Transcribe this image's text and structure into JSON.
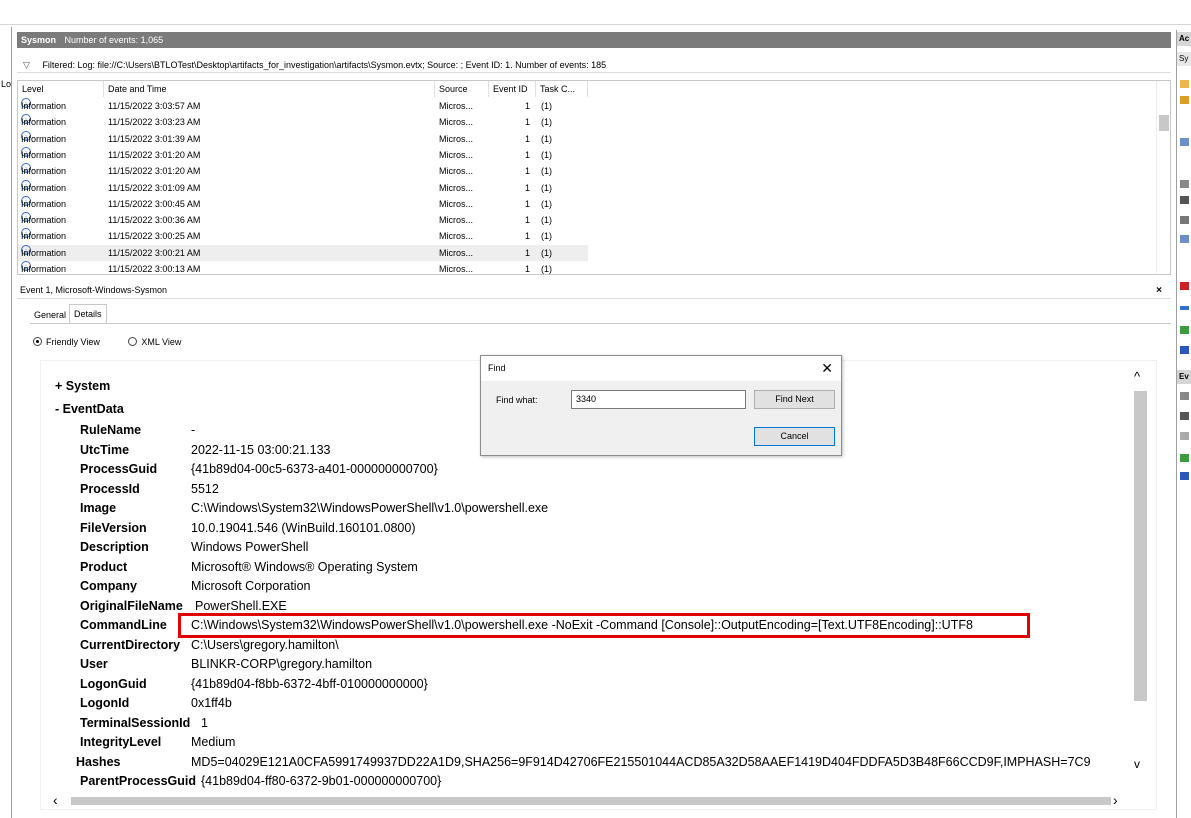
{
  "left_strip": {
    "label": "Lo"
  },
  "events_header": {
    "title": "Sysmon",
    "count_text": "Number of events: 1,065"
  },
  "filter": {
    "text": "Filtered: Log: file://C:\\Users\\BTLOTest\\Desktop\\artifacts_for_investigation\\artifacts\\Sysmon.evtx; Source: ; Event ID: 1. Number of events: 185"
  },
  "columns": [
    "Level",
    "Date and Time",
    "Source",
    "Event ID",
    "Task C..."
  ],
  "rows": [
    {
      "level": "Information",
      "date": "11/15/2022 3:03:57 AM",
      "source": "Micros...",
      "event_id": "1",
      "task": "(1)"
    },
    {
      "level": "Information",
      "date": "11/15/2022 3:03:23 AM",
      "source": "Micros...",
      "event_id": "1",
      "task": "(1)"
    },
    {
      "level": "Information",
      "date": "11/15/2022 3:01:39 AM",
      "source": "Micros...",
      "event_id": "1",
      "task": "(1)"
    },
    {
      "level": "Information",
      "date": "11/15/2022 3:01:20 AM",
      "source": "Micros...",
      "event_id": "1",
      "task": "(1)"
    },
    {
      "level": "Information",
      "date": "11/15/2022 3:01:20 AM",
      "source": "Micros...",
      "event_id": "1",
      "task": "(1)"
    },
    {
      "level": "Information",
      "date": "11/15/2022 3:01:09 AM",
      "source": "Micros...",
      "event_id": "1",
      "task": "(1)"
    },
    {
      "level": "Information",
      "date": "11/15/2022 3:00:45 AM",
      "source": "Micros...",
      "event_id": "1",
      "task": "(1)"
    },
    {
      "level": "Information",
      "date": "11/15/2022 3:00:36 AM",
      "source": "Micros...",
      "event_id": "1",
      "task": "(1)"
    },
    {
      "level": "Information",
      "date": "11/15/2022 3:00:25 AM",
      "source": "Micros...",
      "event_id": "1",
      "task": "(1)"
    },
    {
      "level": "Information",
      "date": "11/15/2022 3:00:21 AM",
      "source": "Micros...",
      "event_id": "1",
      "task": "(1)",
      "selected": true
    },
    {
      "level": "Information",
      "date": "11/15/2022 3:00:13 AM",
      "source": "Micros...",
      "event_id": "1",
      "task": "(1)"
    }
  ],
  "detail": {
    "header": "Event 1, Microsoft-Windows-Sysmon",
    "close": "×",
    "tabs": [
      "General",
      "Details"
    ],
    "views": [
      "Friendly View",
      "XML View"
    ],
    "system_label": "+ System",
    "eventdata_label": "- EventData",
    "fields": [
      {
        "k": "RuleName",
        "v": "-"
      },
      {
        "k": "UtcTime",
        "v": "2022-11-15 03:00:21.133"
      },
      {
        "k": "ProcessGuid",
        "v": "{41b89d04-00c5-6373-a401-000000000700}"
      },
      {
        "k": "ProcessId",
        "v": "5512"
      },
      {
        "k": "Image",
        "v": "C:\\Windows\\System32\\WindowsPowerShell\\v1.0\\powershell.exe"
      },
      {
        "k": "FileVersion",
        "v": "10.0.19041.546 (WinBuild.160101.0800)"
      },
      {
        "k": "Description",
        "v": "Windows PowerShell"
      },
      {
        "k": "Product",
        "v": "Microsoft® Windows® Operating System"
      },
      {
        "k": "Company",
        "v": "Microsoft Corporation"
      },
      {
        "k": "OriginalFileName",
        "v": "PowerShell.EXE"
      },
      {
        "k": "CommandLine",
        "v": "C:\\Windows\\System32\\WindowsPowerShell\\v1.0\\powershell.exe -NoExit -Command [Console]::OutputEncoding=[Text.UTF8Encoding]::UTF8"
      },
      {
        "k": "CurrentDirectory",
        "v": "C:\\Users\\gregory.hamilton\\"
      },
      {
        "k": "User",
        "v": "BLINKR-CORP\\gregory.hamilton"
      },
      {
        "k": "LogonGuid",
        "v": "{41b89d04-f8bb-6372-4bff-010000000000}"
      },
      {
        "k": "LogonId",
        "v": "0x1ff4b"
      },
      {
        "k": "TerminalSessionId",
        "v": "1"
      },
      {
        "k": "IntegrityLevel",
        "v": "Medium"
      },
      {
        "k": "Hashes",
        "v": "MD5=04029E121A0CFA5991749937DD22A1D9,SHA256=9F914D42706FE215501044ACD85A32D58AAEF1419D404FDDFA5D3B48F66CCD9F,IMPHASH=7C9"
      },
      {
        "k": "ParentProcessGuid",
        "v": "{41b89d04-ff80-6372-9b01-000000000700}"
      }
    ]
  },
  "find_dialog": {
    "title": "Find",
    "close": "✕",
    "label": "Find what:",
    "value": "3340",
    "find_next": "Find Next",
    "cancel": "Cancel"
  },
  "actions_pane": {
    "headers": [
      "Ac",
      "Sy",
      "Ev"
    ]
  }
}
